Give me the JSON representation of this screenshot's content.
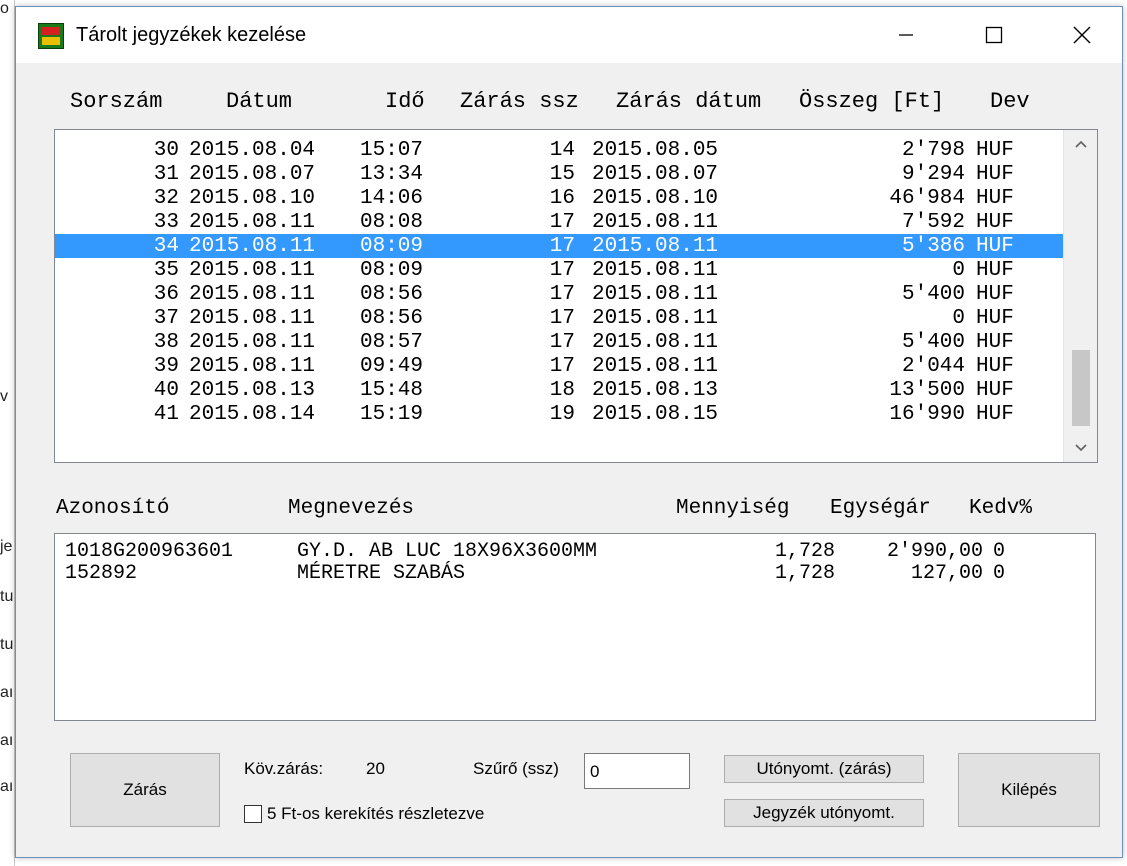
{
  "background": {
    "fragments": [
      "o",
      "v",
      "je",
      "tu",
      "tu",
      "aı",
      "aı",
      "aı"
    ]
  },
  "window": {
    "title": "Tárolt jegyzékek kezelése",
    "icon": "app-icon",
    "controls": {
      "minimize": "minimize-icon",
      "maximize": "maximize-icon",
      "close": "close-icon"
    }
  },
  "receipts": {
    "headers": {
      "num": "Sorszám",
      "date": "Dátum",
      "time": "Idő",
      "closing_num": "Zárás ssz",
      "closing_date": "Zárás dátum",
      "amount": "Összeg [Ft]",
      "currency": "Dev"
    },
    "selected_index": 4,
    "rows": [
      {
        "num": "30",
        "date": "2015.08.04",
        "time": "15:07",
        "closing_num": "14",
        "closing_date": "2015.08.05",
        "amount": "2'798",
        "currency": "HUF"
      },
      {
        "num": "31",
        "date": "2015.08.07",
        "time": "13:34",
        "closing_num": "15",
        "closing_date": "2015.08.07",
        "amount": "9'294",
        "currency": "HUF"
      },
      {
        "num": "32",
        "date": "2015.08.10",
        "time": "14:06",
        "closing_num": "16",
        "closing_date": "2015.08.10",
        "amount": "46'984",
        "currency": "HUF"
      },
      {
        "num": "33",
        "date": "2015.08.11",
        "time": "08:08",
        "closing_num": "17",
        "closing_date": "2015.08.11",
        "amount": "7'592",
        "currency": "HUF"
      },
      {
        "num": "34",
        "date": "2015.08.11",
        "time": "08:09",
        "closing_num": "17",
        "closing_date": "2015.08.11",
        "amount": "5'386",
        "currency": "HUF"
      },
      {
        "num": "35",
        "date": "2015.08.11",
        "time": "08:09",
        "closing_num": "17",
        "closing_date": "2015.08.11",
        "amount": "0",
        "currency": "HUF"
      },
      {
        "num": "36",
        "date": "2015.08.11",
        "time": "08:56",
        "closing_num": "17",
        "closing_date": "2015.08.11",
        "amount": "5'400",
        "currency": "HUF"
      },
      {
        "num": "37",
        "date": "2015.08.11",
        "time": "08:56",
        "closing_num": "17",
        "closing_date": "2015.08.11",
        "amount": "0",
        "currency": "HUF"
      },
      {
        "num": "38",
        "date": "2015.08.11",
        "time": "08:57",
        "closing_num": "17",
        "closing_date": "2015.08.11",
        "amount": "5'400",
        "currency": "HUF"
      },
      {
        "num": "39",
        "date": "2015.08.11",
        "time": "09:49",
        "closing_num": "17",
        "closing_date": "2015.08.11",
        "amount": "2'044",
        "currency": "HUF"
      },
      {
        "num": "40",
        "date": "2015.08.13",
        "time": "15:48",
        "closing_num": "18",
        "closing_date": "2015.08.13",
        "amount": "13'500",
        "currency": "HUF"
      },
      {
        "num": "41",
        "date": "2015.08.14",
        "time": "15:19",
        "closing_num": "19",
        "closing_date": "2015.08.15",
        "amount": "16'990",
        "currency": "HUF"
      }
    ]
  },
  "items": {
    "headers": {
      "id": "Azonosító",
      "name": "Megnevezés",
      "qty": "Mennyiség",
      "price": "Egységár",
      "discount": "Kedv%"
    },
    "rows": [
      {
        "id": "1018G200963601",
        "name": "GY.D. AB LUC 18X96X3600MM",
        "qty": "1,728",
        "price": "2'990,00",
        "discount": "0"
      },
      {
        "id": "152892",
        "name": "MÉRETRE SZABÁS",
        "qty": "1,728",
        "price": "127,00",
        "discount": "0"
      }
    ]
  },
  "footer": {
    "close_button": "Zárás",
    "next_closing_label": "Köv.zárás:",
    "next_closing_value": "20",
    "filter_label": "Szűrő (ssz)",
    "filter_value": "0",
    "reprint_closing_button": "Utónyomt. (zárás)",
    "reprint_receipt_button": "Jegyzék utónyomt.",
    "rounding_checkbox_label": "5 Ft-os kerekítés részletezve",
    "rounding_checked": false,
    "exit_button": "Kilépés"
  },
  "colors": {
    "selection": "#3399ff",
    "window_bg": "#f0f0f0",
    "button_bg": "#e1e1e1"
  }
}
